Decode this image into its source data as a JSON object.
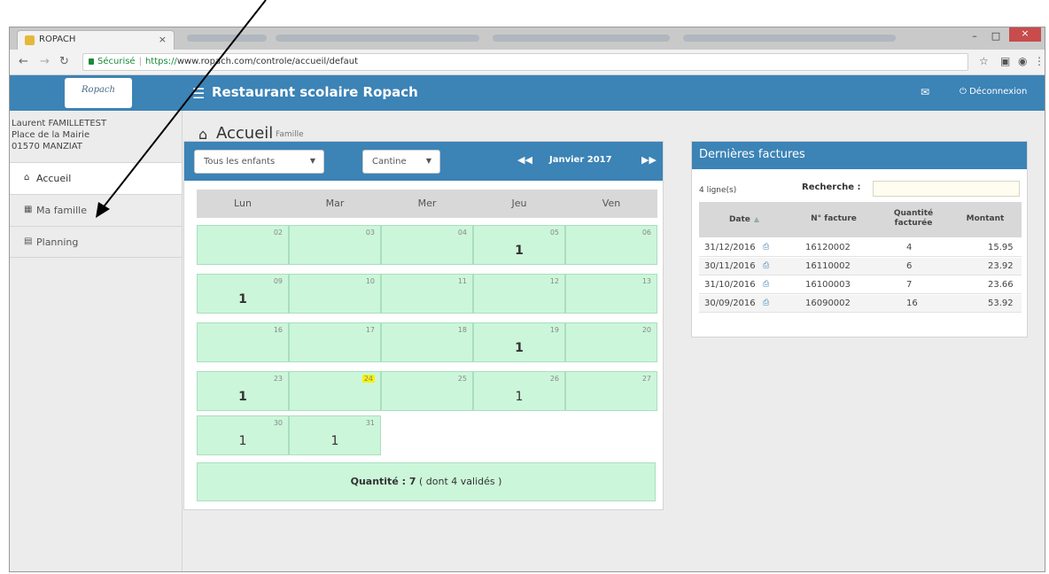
{
  "browser": {
    "tab_title": "ROPACH",
    "tab_close": "×",
    "address_secure": "Sécurisé",
    "address_protocol": "https://",
    "address_rest": "www.ropach.com/controle/accueil/defaut",
    "win_min": "–",
    "win_max": "□",
    "win_close": "×"
  },
  "topnav": {
    "logo_text": "Ropach",
    "title": "Restaurant scolaire Ropach",
    "logout": "Déconnexion"
  },
  "sidebar": {
    "user_name": "Laurent FAMILLETEST",
    "user_addr1": "Place de la Mairie",
    "user_addr2": "01570 MANZIAT",
    "items": [
      {
        "label": "Accueil",
        "icon": "home-icon"
      },
      {
        "label": "Ma famille",
        "icon": "grid-icon"
      },
      {
        "label": "Planning",
        "icon": "calendar-icon"
      }
    ]
  },
  "page": {
    "title": "Accueil",
    "subtitle": "Famille"
  },
  "calendar": {
    "filter_children": "Tous les enfants",
    "filter_service": "Cantine",
    "month": "Janvier 2017",
    "day_headers": [
      "Lun",
      "Mar",
      "Mer",
      "Jeu",
      "Ven"
    ],
    "weeks": [
      [
        {
          "d": "02",
          "q": ""
        },
        {
          "d": "03",
          "q": ""
        },
        {
          "d": "04",
          "q": ""
        },
        {
          "d": "05",
          "q": "1"
        },
        {
          "d": "06",
          "q": ""
        }
      ],
      [
        {
          "d": "09",
          "q": "1"
        },
        {
          "d": "10",
          "q": ""
        },
        {
          "d": "11",
          "q": ""
        },
        {
          "d": "12",
          "q": ""
        },
        {
          "d": "13",
          "q": ""
        }
      ],
      [
        {
          "d": "16",
          "q": ""
        },
        {
          "d": "17",
          "q": ""
        },
        {
          "d": "18",
          "q": ""
        },
        {
          "d": "19",
          "q": "1"
        },
        {
          "d": "20",
          "q": ""
        }
      ],
      [
        {
          "d": "23",
          "q": "1"
        },
        {
          "d": "24",
          "q": ""
        },
        {
          "d": "25",
          "q": ""
        },
        {
          "d": "26",
          "q": "1"
        },
        {
          "d": "27",
          "q": ""
        }
      ],
      [
        {
          "d": "30",
          "q": "1"
        },
        {
          "d": "31",
          "q": "1"
        }
      ]
    ],
    "total_label": "Quantité : 7",
    "total_detail": " ( dont 4 validés )"
  },
  "invoices": {
    "title": "Dernières factures",
    "count": "4 ligne(s)",
    "search_label": "Recherche :",
    "search_value": "",
    "columns": [
      "Date",
      "N° facture",
      "Quantité facturée",
      "Montant"
    ],
    "rows": [
      [
        "31/12/2016",
        "16120002",
        "4",
        "15.95"
      ],
      [
        "30/11/2016",
        "16110002",
        "6",
        "23.92"
      ],
      [
        "31/10/2016",
        "16100003",
        "7",
        "23.66"
      ],
      [
        "30/09/2016",
        "16090002",
        "16",
        "53.92"
      ]
    ]
  },
  "colors": {
    "header_blue": "#3c83b6",
    "day_green": "#ccf6da",
    "today_yellow": "#f7f200"
  }
}
